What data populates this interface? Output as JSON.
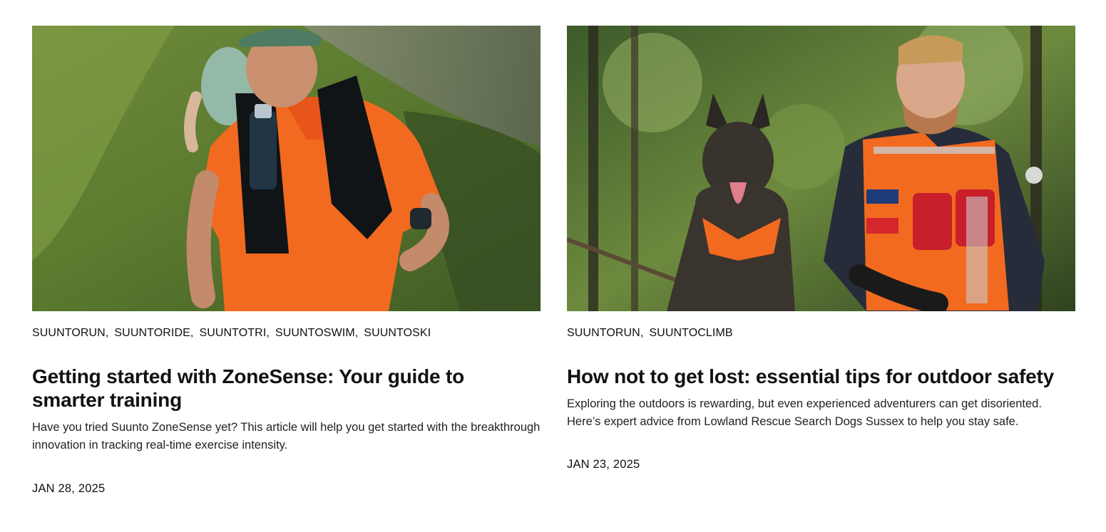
{
  "articles": [
    {
      "image_alt": "Trail runner in orange shirt and black running vest on a grassy hillside",
      "tags": [
        "SUUNTORUN",
        "SUUNTORIDE",
        "SUUNTOTRI",
        "SUUNTOSWIM",
        "SUUNTOSKI"
      ],
      "title": "Getting started with ZoneSense: Your guide to smarter training",
      "excerpt": "Have you tried Suunto ZoneSense yet? This article will help you get started with the breakthrough innovation in tracking real-time exercise intensity.",
      "date": "JAN 28, 2025"
    },
    {
      "image_alt": "Rescue team leader in orange hi-vis jacket kneeling next to a search dog in a forest",
      "tags": [
        "SUUNTORUN",
        "SUUNTOCLIMB"
      ],
      "title": "How not to get lost: essential tips for outdoor safety",
      "excerpt": "Exploring the outdoors is rewarding, but even experienced adventurers can get disoriented. Here’s expert advice from Lowland Rescue Search Dogs Sussex to help you stay safe.",
      "date": "JAN 23, 2025"
    }
  ],
  "colors": {
    "text": "#111111",
    "accent_orange": "#f26a1f",
    "background": "#ffffff"
  }
}
